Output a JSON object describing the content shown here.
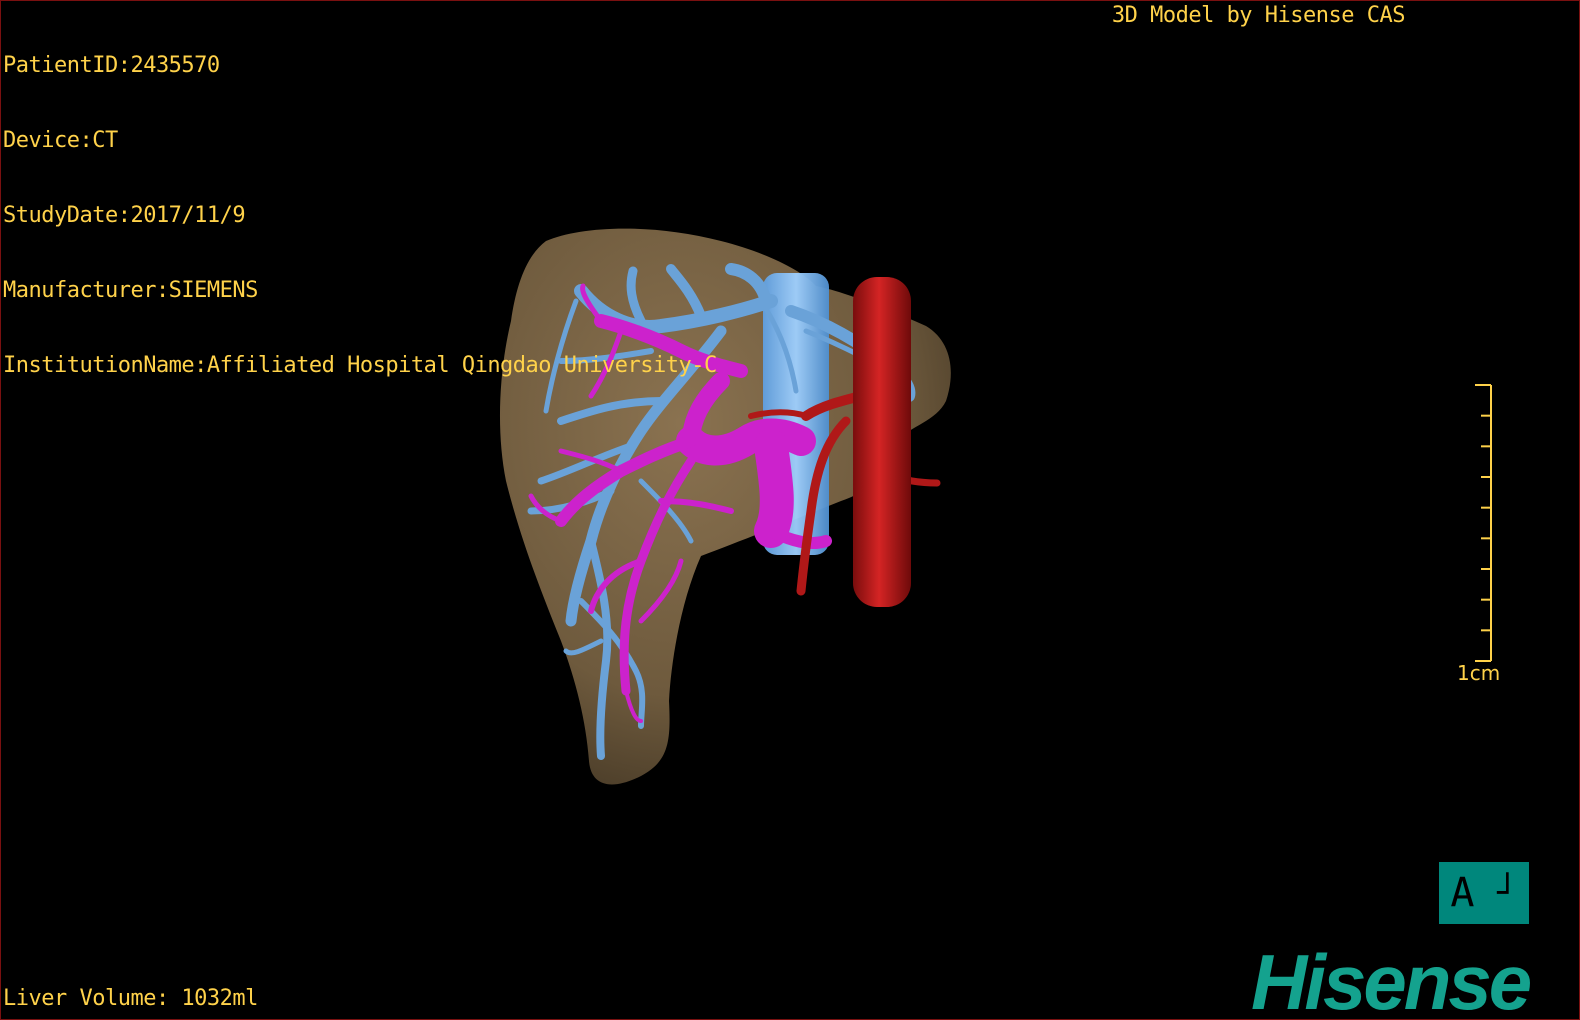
{
  "patient_info": {
    "patient_id": "PatientID:2435570",
    "device": "Device:CT",
    "study_date": "StudyDate:2017/11/9",
    "manufacturer": "Manufacturer:SIEMENS",
    "institution": "InstitutionName:Affiliated Hospital Qingdao University-C"
  },
  "credit": "3D Model by Hisense CAS",
  "liver_volume": "Liver Volume: 1032ml",
  "scale": {
    "label": "1cm",
    "ticks": 10
  },
  "orientation": {
    "label": "A",
    "marker": "┘"
  },
  "brand": {
    "logo_text": "Hisense"
  },
  "colors": {
    "overlay_text": "#ffd24a",
    "liver": "#7a6446",
    "hepatic_vein": "#6aa2d8",
    "portal_vein": "#cc22cc",
    "artery": "#b01818",
    "ivc": "#74b4ec",
    "brand": "#14a28e",
    "orientation_cube": "#00877c"
  }
}
